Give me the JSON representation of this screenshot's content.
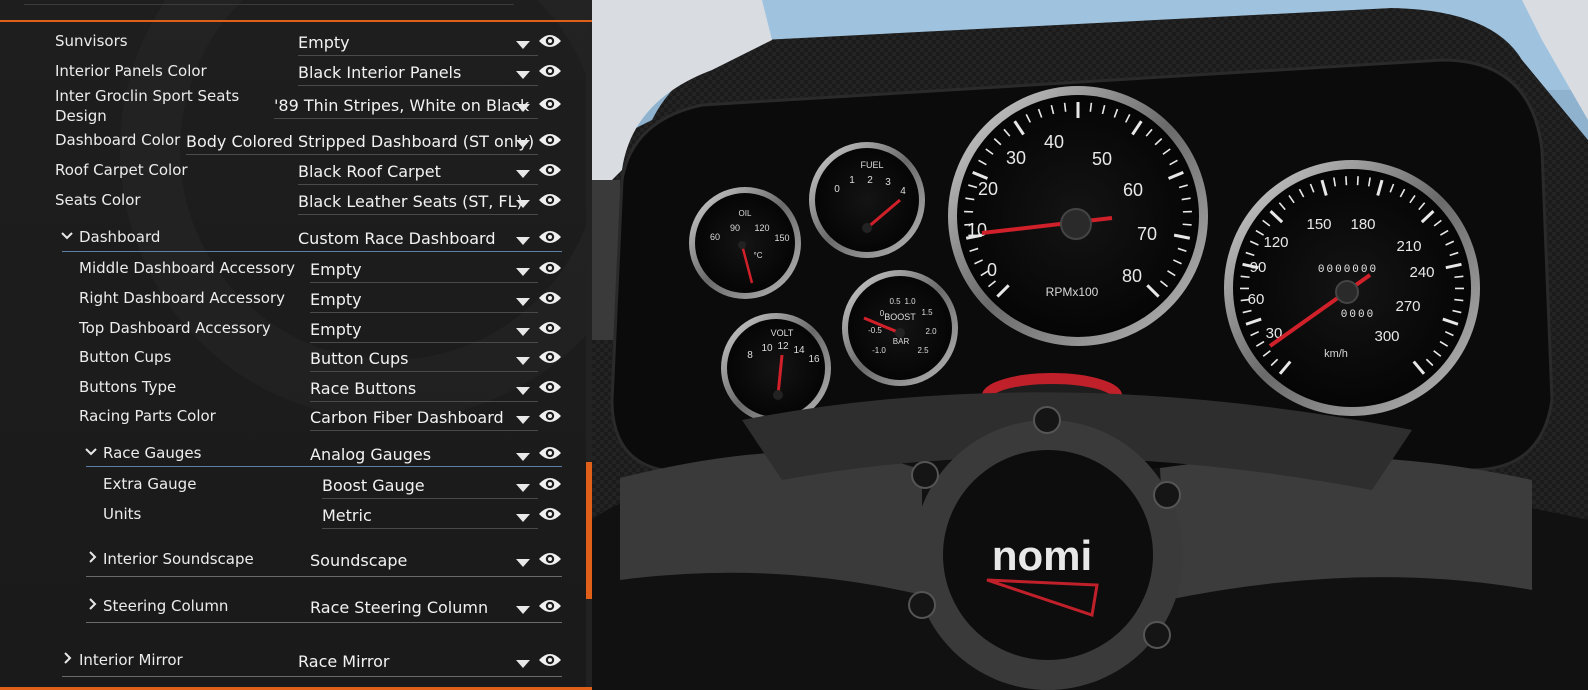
{
  "rows": [
    {
      "label": "Sunvisors",
      "value": "Empty"
    },
    {
      "label": "Interior Panels Color",
      "value": "Black Interior Panels"
    },
    {
      "label": "Inter Groclin Sport Seats Design",
      "value": "'89 Thin Stripes, White on Black"
    },
    {
      "label": "Dashboard Color",
      "value": "Body Colored Stripped Dashboard (ST only)"
    },
    {
      "label": "Roof Carpet Color",
      "value": "Black Roof Carpet"
    },
    {
      "label": "Seats Color",
      "value": "Black Leather Seats (ST, FL)"
    },
    {
      "label": "Dashboard",
      "value": "Custom Race Dashboard"
    },
    {
      "label": "Middle Dashboard Accessory",
      "value": "Empty"
    },
    {
      "label": "Right Dashboard Accessory",
      "value": "Empty"
    },
    {
      "label": "Top Dashboard Accessory",
      "value": "Empty"
    },
    {
      "label": "Button Cups",
      "value": "Button Cups"
    },
    {
      "label": "Buttons Type",
      "value": "Race Buttons"
    },
    {
      "label": "Racing Parts Color",
      "value": "Carbon Fiber Dashboard"
    },
    {
      "label": "Race Gauges",
      "value": "Analog Gauges"
    },
    {
      "label": "Extra Gauge",
      "value": "Boost Gauge"
    },
    {
      "label": "Units",
      "value": "Metric"
    },
    {
      "label": "Interior Soundscape",
      "value": "Soundscape"
    },
    {
      "label": "Steering Column",
      "value": "Race Steering Column"
    },
    {
      "label": "Interior Mirror",
      "value": "Race Mirror"
    }
  ],
  "gauges": {
    "oil": {
      "title": "OIL",
      "unit": "°C",
      "ticks": [
        "60",
        "90",
        "120",
        "150"
      ]
    },
    "fuel": {
      "title": "FUEL",
      "ticks": [
        "0",
        "1",
        "2",
        "3",
        "4"
      ]
    },
    "volt": {
      "title": "VOLT",
      "ticks": [
        "8",
        "10",
        "12",
        "14",
        "16"
      ]
    },
    "boost": {
      "title": "BOOST",
      "unit": "BAR",
      "ticks": [
        "-1.0",
        "-0.5",
        "0",
        "0.5",
        "1.0",
        "1.5",
        "2.0",
        "2.5"
      ]
    },
    "tach": {
      "unit": "RPMx100",
      "ticks": [
        "0",
        "10",
        "20",
        "30",
        "40",
        "50",
        "60",
        "70",
        "80"
      ]
    },
    "speedo": {
      "unit": "km/h",
      "ticks": [
        "30",
        "60",
        "90",
        "120",
        "150",
        "180",
        "210",
        "240",
        "270",
        "300"
      ],
      "odometer": "0000000",
      "trip": "0000"
    }
  },
  "wheel": {
    "logo": "nomi"
  },
  "colors": {
    "accent": "#e0601a",
    "needle": "#d0202a",
    "section_line": "#5a7fa8"
  }
}
